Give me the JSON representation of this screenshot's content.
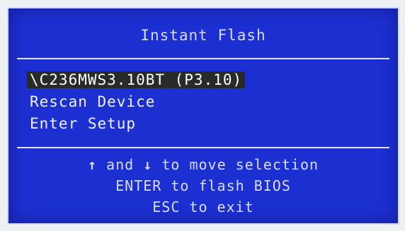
{
  "window": {
    "title": "Instant Flash"
  },
  "menu": {
    "items": [
      {
        "label": "\\C236MWS3.10BT (P3.10)",
        "selected": true
      },
      {
        "label": "Rescan Device",
        "selected": false
      },
      {
        "label": "Enter Setup",
        "selected": false
      }
    ]
  },
  "help": {
    "up_arrow": "↑",
    "and_text": " and ",
    "down_arrow": "↓",
    "move_text": " to move selection",
    "enter_line": "ENTER to flash BIOS",
    "esc_line": "ESC to exit"
  },
  "colors": {
    "panel_background": "#1c2fd0",
    "text": "#e9ecff",
    "selection_background": "#2a2a2a",
    "divider": "#dfe3ff"
  }
}
